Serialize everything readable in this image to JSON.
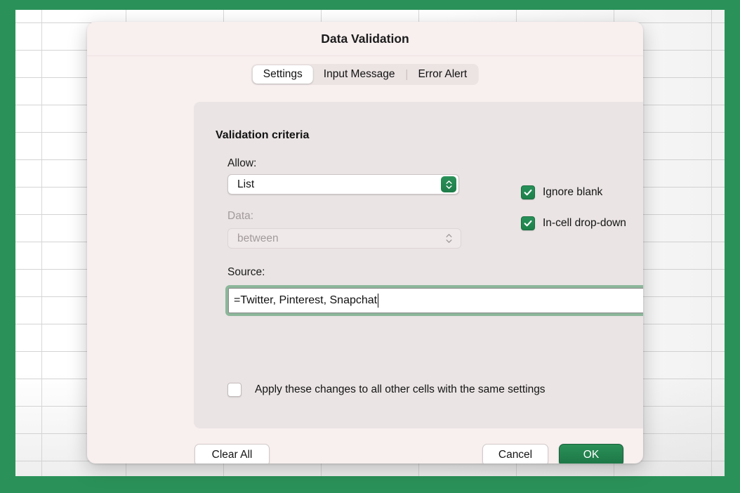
{
  "theme": {
    "window_green": "#2a9259",
    "dialog_bg": "#f8efef",
    "panel_bg": "#eae4e4",
    "accent_green": "#1d7a4b",
    "focus_ring_green": "#8cb79a"
  },
  "dialog": {
    "title": "Data Validation",
    "tabs": [
      {
        "label": "Settings",
        "active": true
      },
      {
        "label": "Input Message",
        "active": false
      },
      {
        "label": "Error Alert",
        "active": false
      }
    ],
    "section_title": "Validation criteria",
    "allow": {
      "label": "Allow:",
      "value": "List",
      "stepper_icon": "chevron-up-down-icon"
    },
    "data": {
      "label": "Data:",
      "value": "between",
      "disabled": true,
      "stepper_icon": "chevron-up-down-icon"
    },
    "source": {
      "label": "Source:",
      "value": "=Twitter, Pinterest, Snapchat",
      "focused": true,
      "picker_icon": "range-selector-icon"
    },
    "options": [
      {
        "label": "Ignore blank",
        "checked": true
      },
      {
        "label": "In-cell drop-down",
        "checked": true
      }
    ],
    "apply_all": {
      "label": "Apply these changes to all other cells with the same settings",
      "checked": false
    },
    "buttons": {
      "clear_all": "Clear All",
      "cancel": "Cancel",
      "ok": "OK"
    }
  }
}
